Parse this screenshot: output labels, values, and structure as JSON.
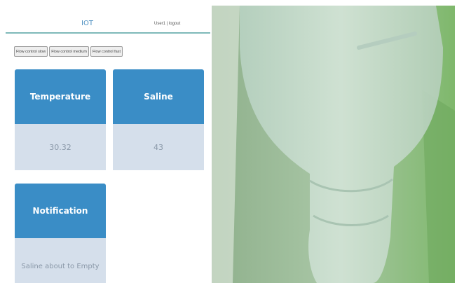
{
  "header": {
    "title": "IOT",
    "user_links": "User1 | logout"
  },
  "flow_controls": [
    {
      "label": "Flow control slow"
    },
    {
      "label": "Flow control medium"
    },
    {
      "label": "Flow control fast"
    }
  ],
  "cards": {
    "temperature": {
      "title": "Temperature",
      "value": "30.32"
    },
    "saline": {
      "title": "Saline",
      "value": "43"
    },
    "notification": {
      "title": "Notification",
      "value": "Saline about to Empty"
    }
  },
  "photo": {
    "subject": "saline-bottle-photo",
    "colors": {
      "background": "#9fc39d",
      "bottle": "#c9ddd0",
      "light": "#e6efe6"
    }
  },
  "colors": {
    "card_header": "#3a8dc6",
    "card_body": "#d5dfeb",
    "title_accent": "#4a8ec0",
    "divider": "#7fb9b9"
  }
}
